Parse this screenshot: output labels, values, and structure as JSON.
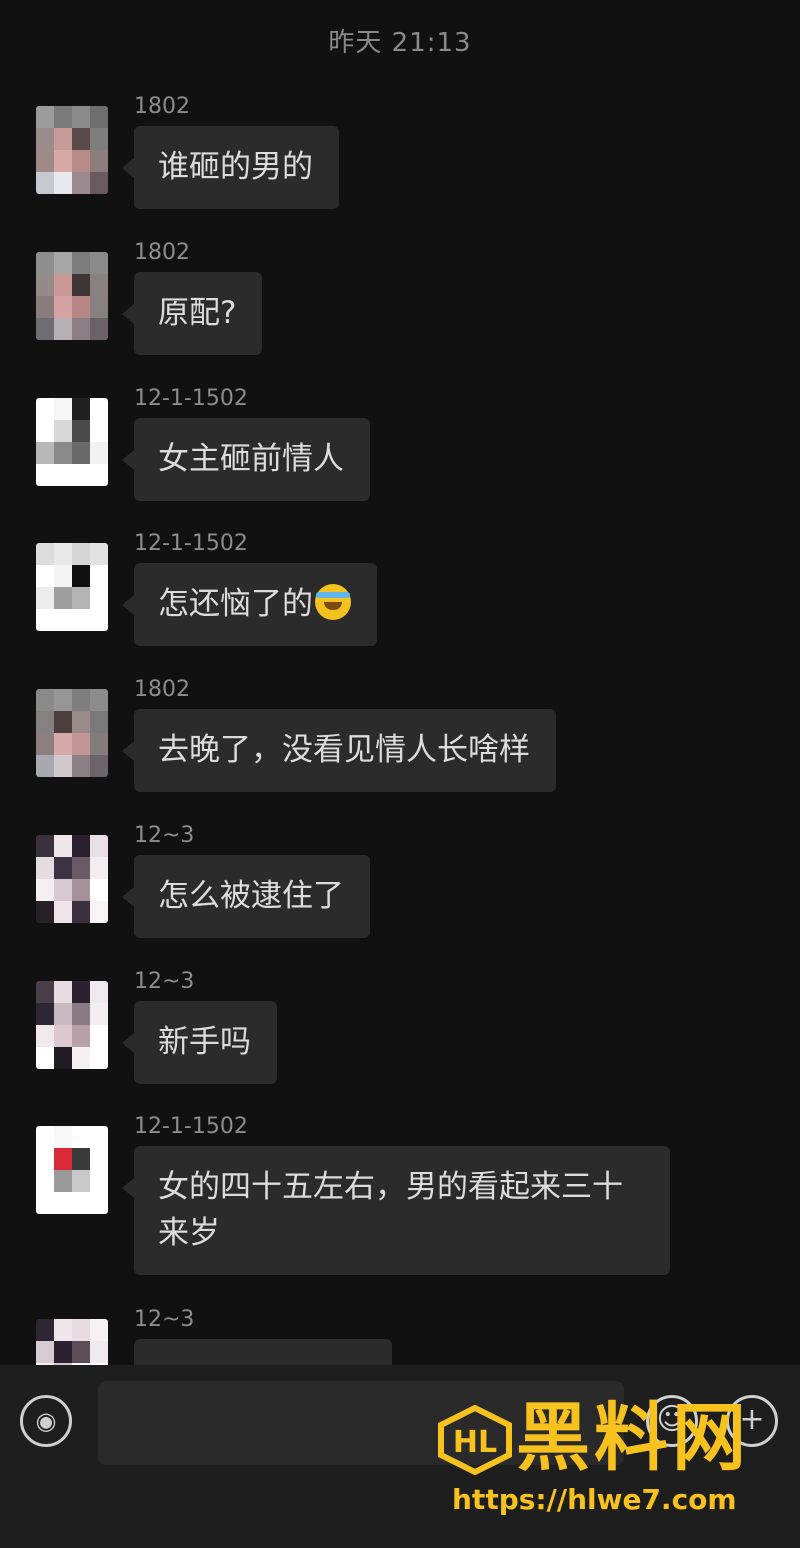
{
  "timestamp": "昨天 21:13",
  "messages": [
    {
      "sender": "1802",
      "text": "谁砸的男的"
    },
    {
      "sender": "1802",
      "text": "原配?"
    },
    {
      "sender": "12-1-1502",
      "text": "女主砸前情人"
    },
    {
      "sender": "12-1-1502",
      "text": "怎还恼了的"
    },
    {
      "sender": "1802",
      "text": "去晚了，没看见情人长啥样"
    },
    {
      "sender": "12~3",
      "text": "怎么被逮住了"
    },
    {
      "sender": "12~3",
      "text": "新手吗"
    },
    {
      "sender": "12-1-1502",
      "text": "女的四十五左右，男的看起来三十来岁"
    },
    {
      "sender": "12~3",
      "text": ""
    }
  ],
  "input": {
    "value": "",
    "placeholder": ""
  },
  "icons": {
    "voice": "voice-icon",
    "emoji": "emoji-icon",
    "plus": "plus-icon"
  },
  "watermark": {
    "title": "黑料网",
    "url": "https://hlwe7.com",
    "color": "#f7c21d"
  }
}
